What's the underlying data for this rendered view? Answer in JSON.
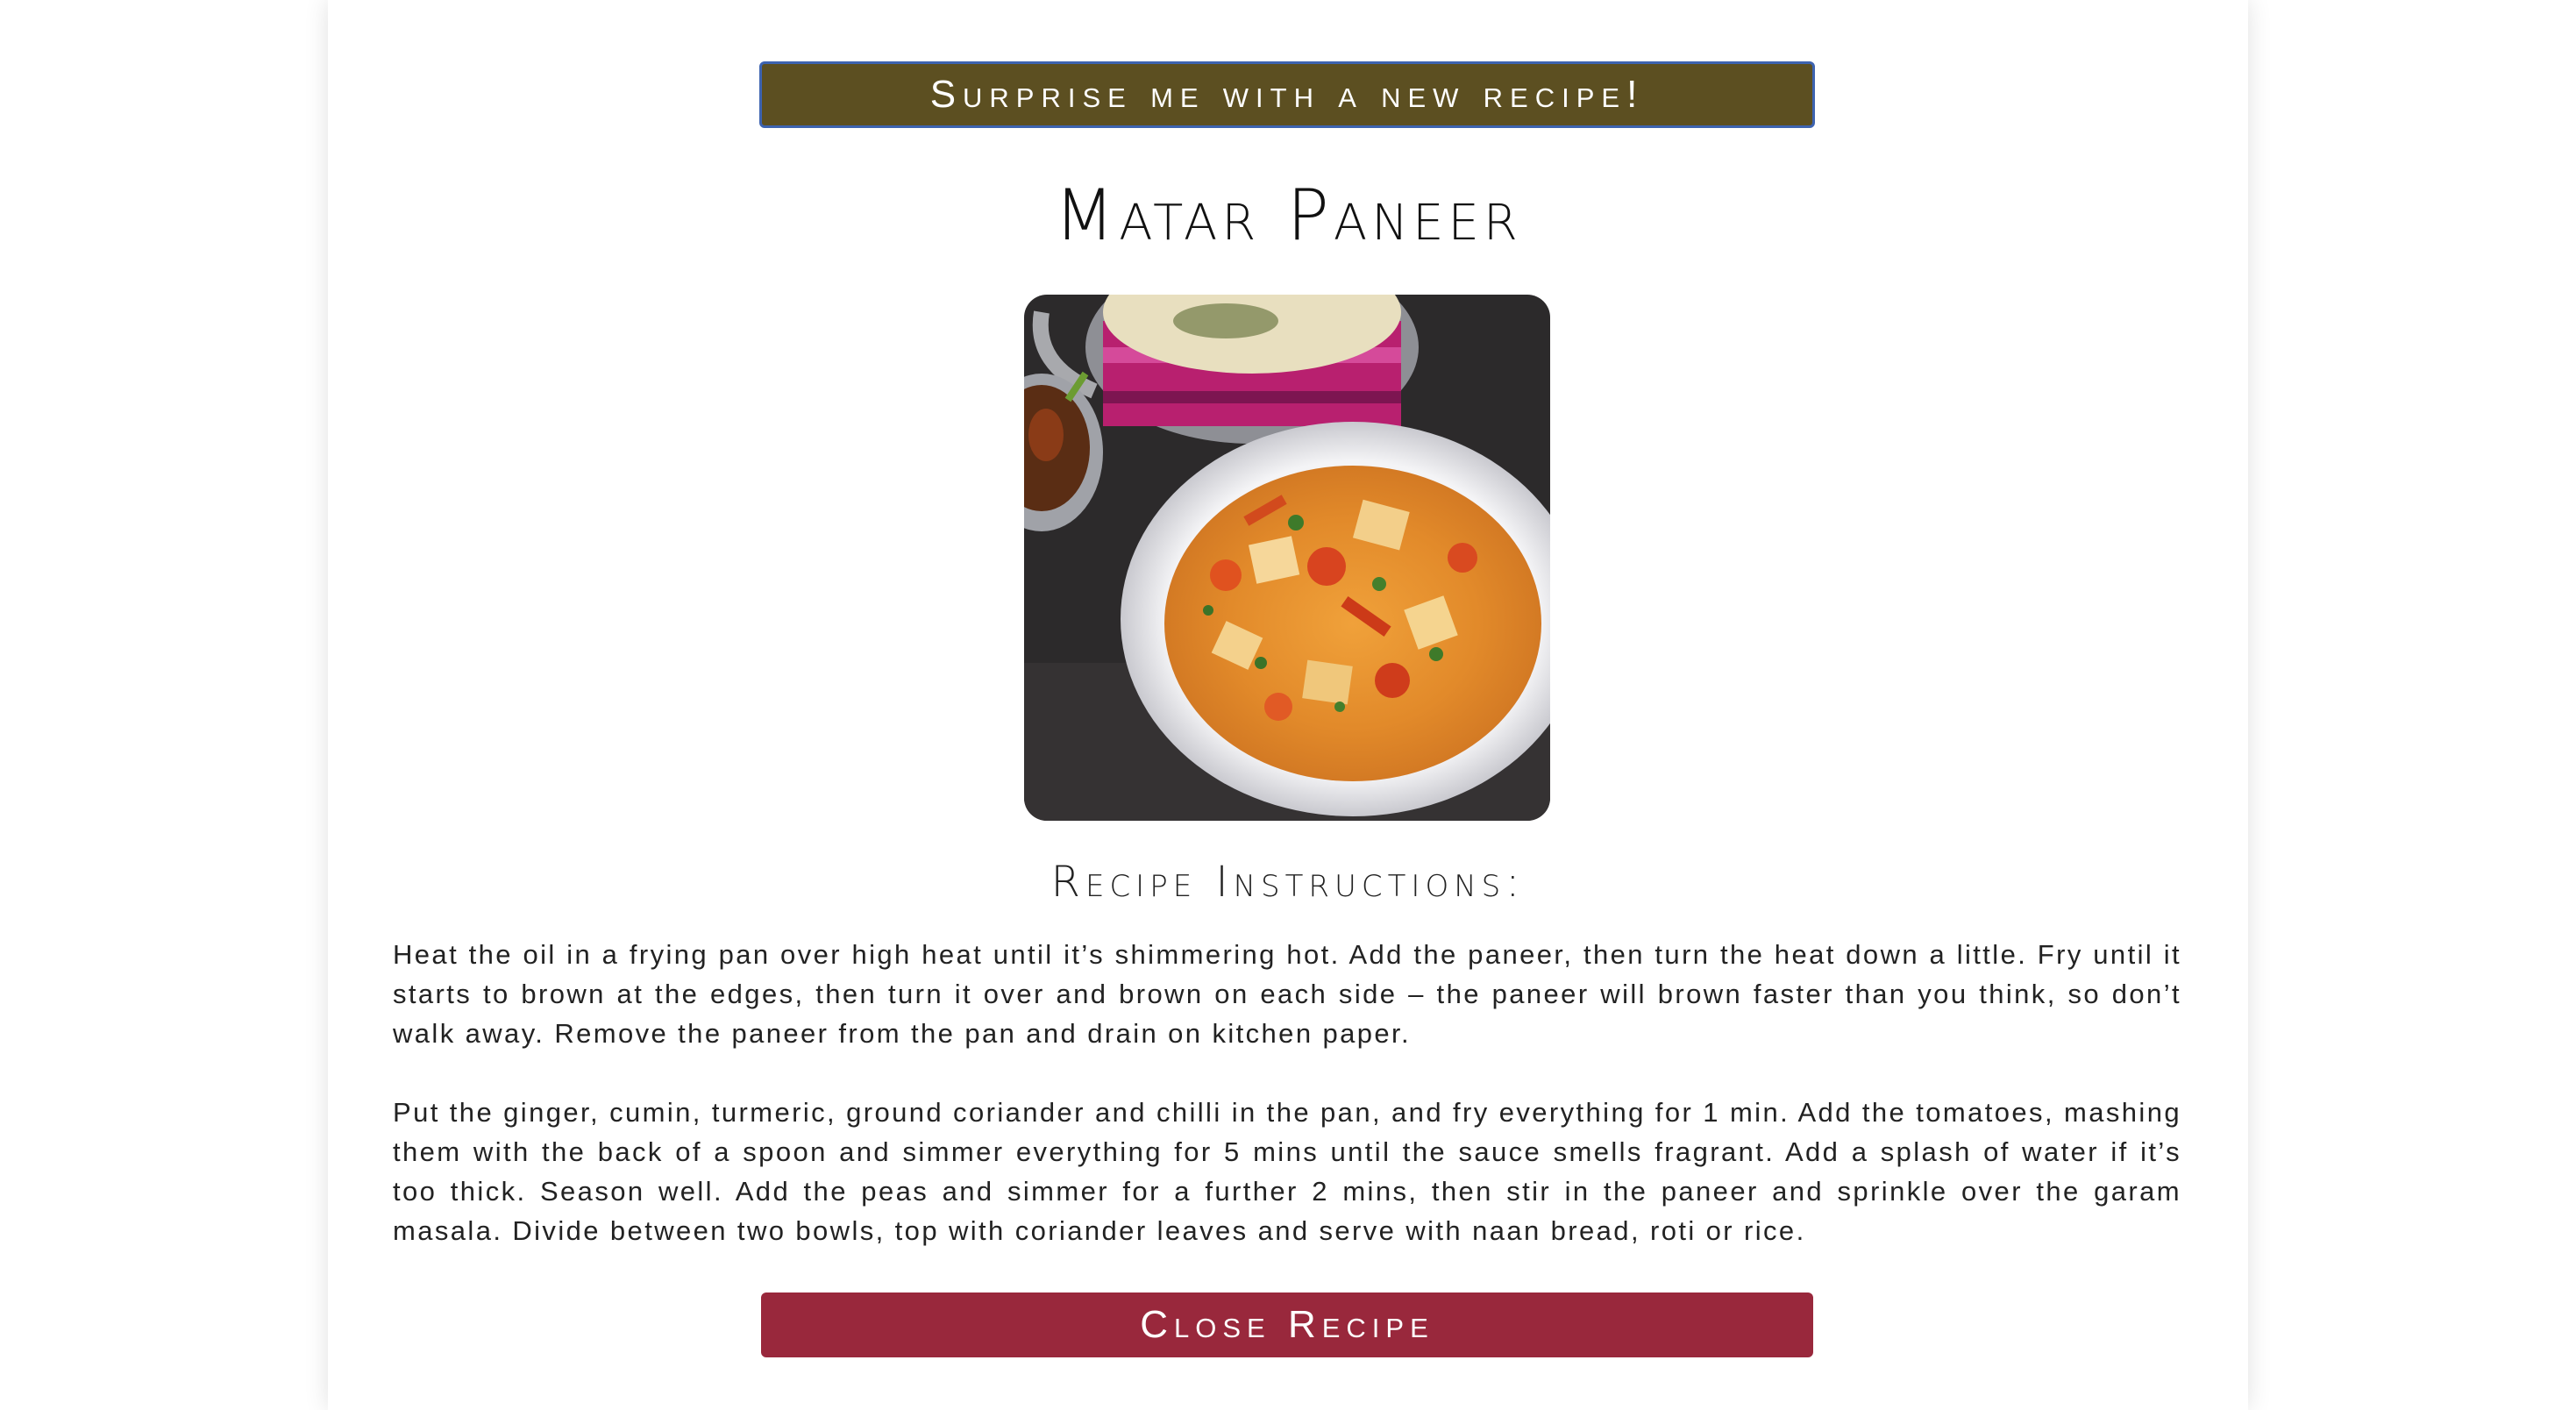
{
  "surprise_button": {
    "label": "Surprise me with a new recipe!"
  },
  "recipe": {
    "title": "Matar Paneer",
    "photo": {
      "description_icon": "food-photo"
    },
    "instructions_heading": "Recipe Instructions:",
    "instructions": [
      "Heat the oil in a frying pan over high heat until it’s shimmering hot. Add the paneer, then turn the heat down a little. Fry until it starts to brown at the edges, then turn it over and brown on each side – the paneer will brown faster than you think, so don’t walk away. Remove the paneer from the pan and drain on kitchen paper.",
      "Put the ginger, cumin, turmeric, ground coriander and chilli in the pan, and fry everything for 1 min. Add the tomatoes, mashing them with the back of a spoon and simmer everything for 5 mins until the sauce smells fragrant. Add a splash of water if it’s too thick. Season well. Add the peas and simmer for a further 2 mins, then stir in the paneer and sprinkle over the garam masala. Divide between two bowls, top with coriander leaves and serve with naan bread, roti or rice."
    ]
  },
  "close_button": {
    "label": "Close Recipe"
  },
  "colors": {
    "surprise_bg": "#5c4f21",
    "surprise_border": "#3d63b0",
    "close_bg": "#99283c"
  }
}
